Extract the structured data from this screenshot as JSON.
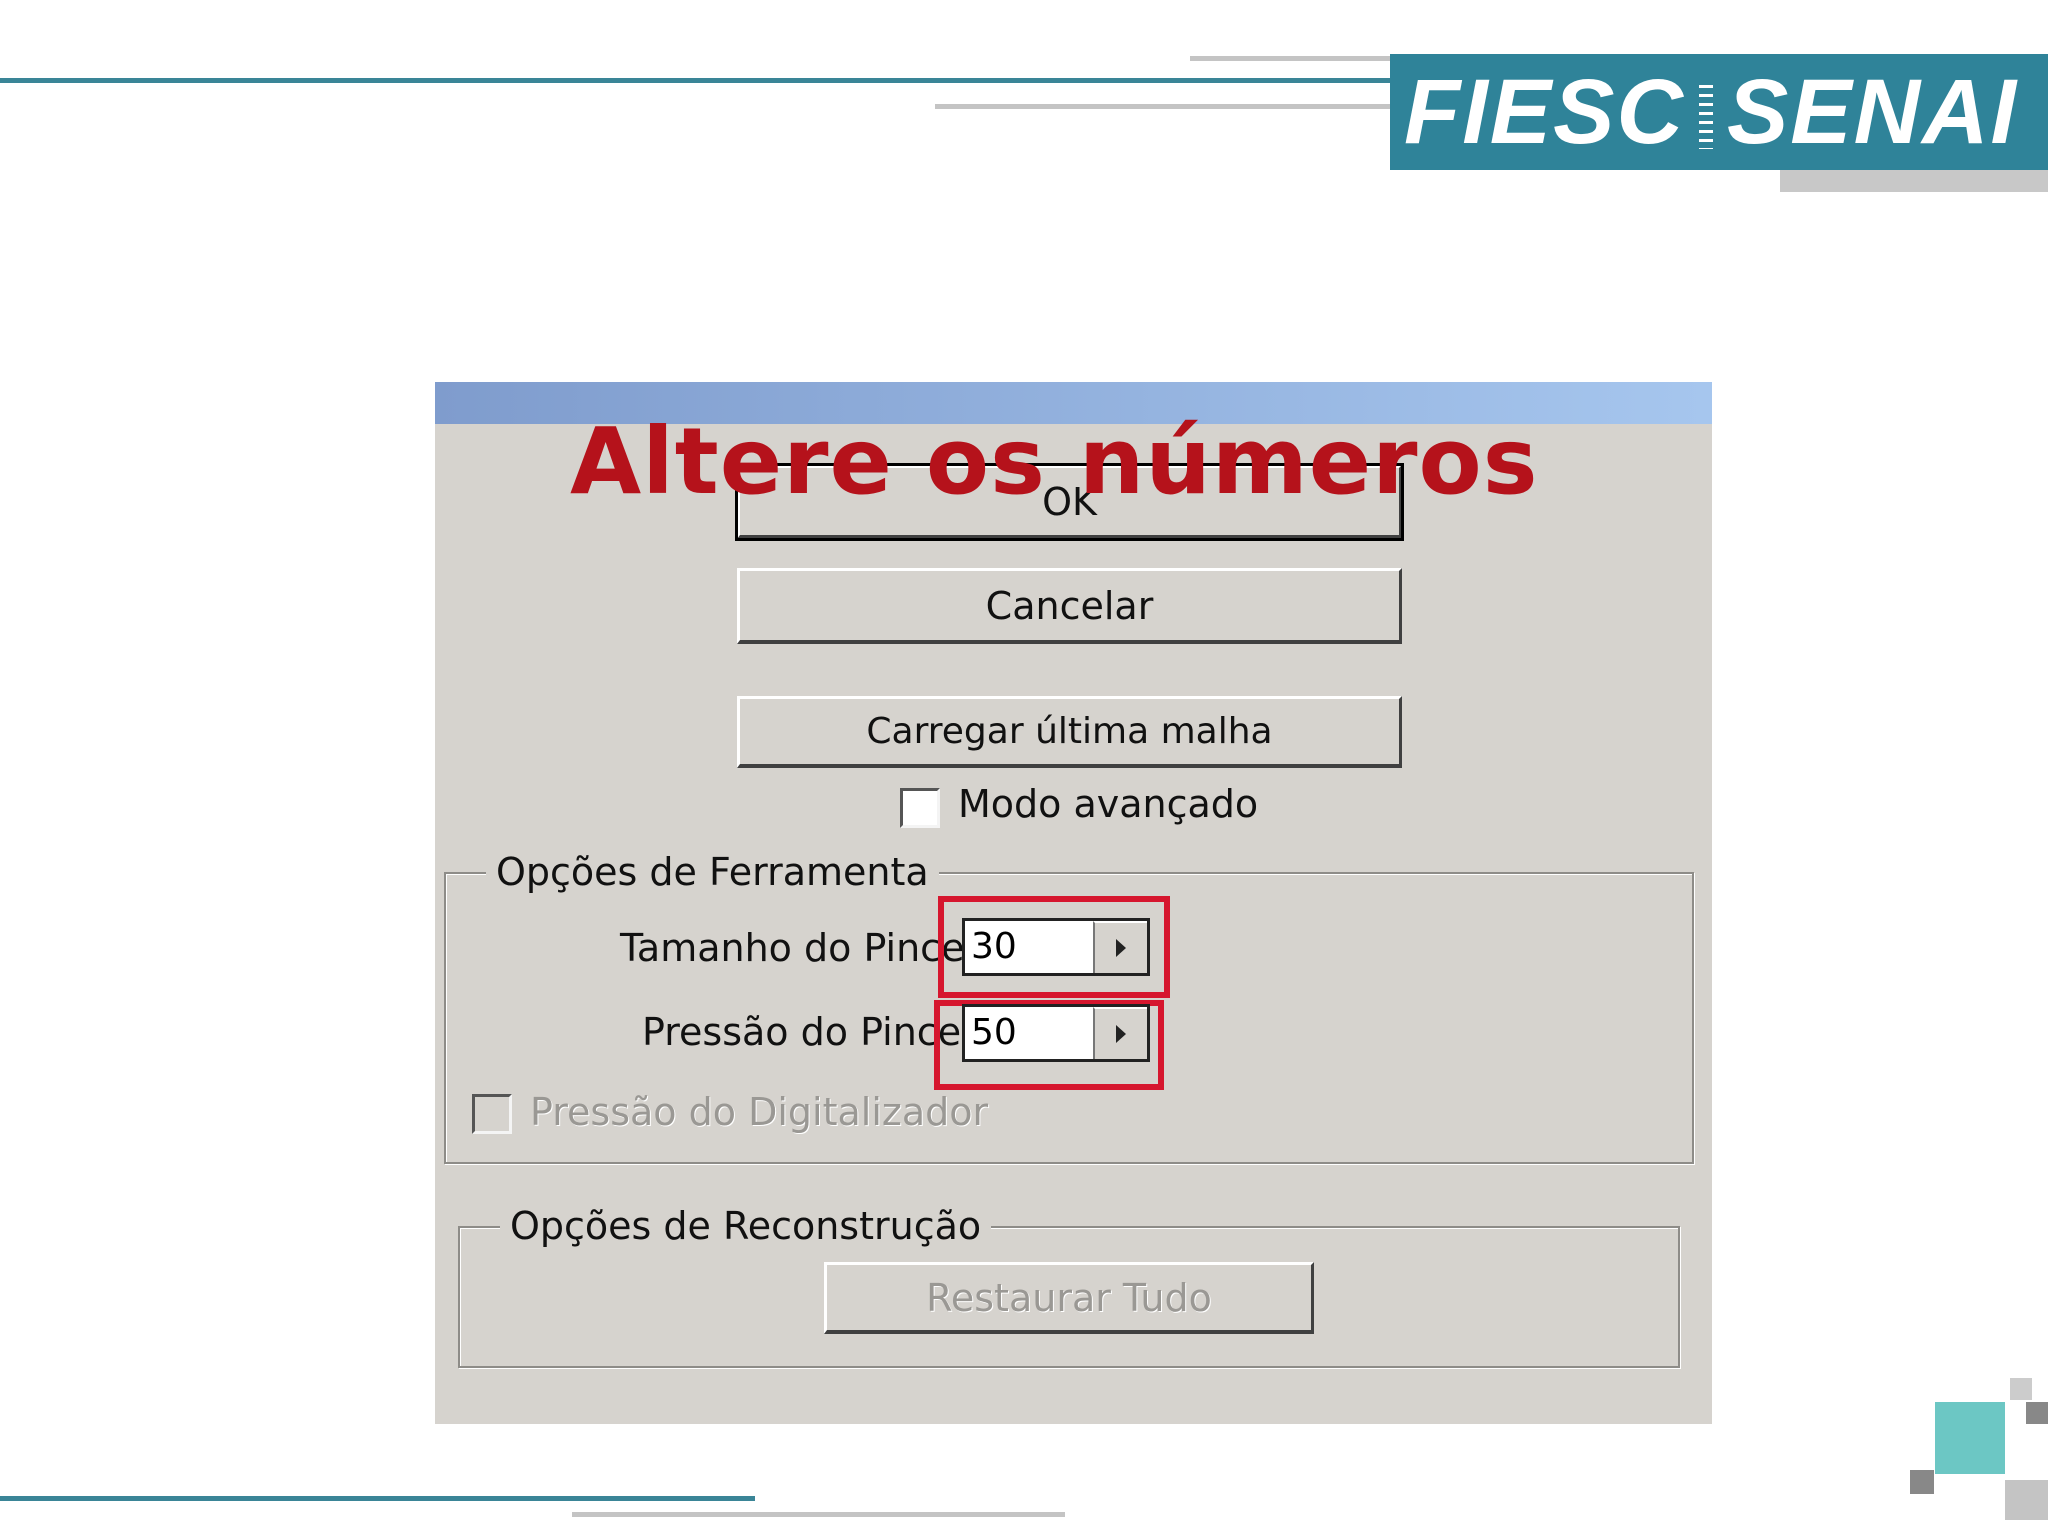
{
  "branding": {
    "logo_left": "FIESC",
    "logo_right": "SENAI"
  },
  "annotation": {
    "text": "Altere os números"
  },
  "dialog": {
    "buttons": {
      "ok": "OK",
      "cancel": "Cancelar",
      "load_last_mesh": "Carregar última malha"
    },
    "advanced_mode": {
      "label": "Modo avançado",
      "checked": false
    },
    "tool_options": {
      "legend": "Opções de Ferramenta",
      "brush_size": {
        "label": "Tamanho do Pincel",
        "value": "30"
      },
      "brush_pressure": {
        "label": "Pressão do Pincel",
        "value": "50"
      },
      "stylus_pressure": {
        "label": "Pressão do Digitalizador",
        "checked": false,
        "enabled": false
      }
    },
    "reconstruction_options": {
      "legend": "Opções de Reconstrução",
      "restore_all": "Restaurar Tudo"
    }
  },
  "colors": {
    "brand_teal": "#2f8399",
    "annotation_red": "#b5121b",
    "highlight_red": "#d6162e",
    "dialog_bg": "#d6d3ce"
  }
}
